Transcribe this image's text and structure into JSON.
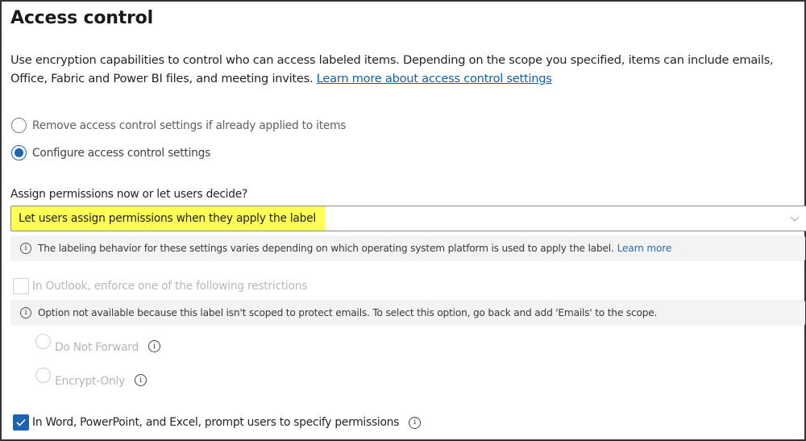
{
  "page": {
    "title": "Access control",
    "description": "Use encryption capabilities to control who can access labeled items. Depending on the scope you specified, items can include emails, Office, Fabric and Power BI files, and meeting invites.",
    "description_link": "Learn more about access control settings"
  },
  "mode_options": [
    {
      "label": "Remove access control settings if already applied to items",
      "selected": false
    },
    {
      "label": "Configure access control settings",
      "selected": true
    }
  ],
  "assign_permissions": {
    "label": "Assign permissions now or let users decide?",
    "selected_value": "Let users assign permissions when they apply the label",
    "highlight_color": "#ffff55",
    "chevron_icon": "chevron-down-icon"
  },
  "platform_info": {
    "icon": "info-icon",
    "text": "The labeling behavior for these settings varies depending on which operating system platform is used to apply the label.",
    "link": "Learn more"
  },
  "outlook_restriction": {
    "label": "In Outlook, enforce one of the following restrictions",
    "checked": false,
    "disabled": true,
    "info_text": "Option not available because this label isn't scoped to protect emails. To select this option, go back and add 'Emails' to the scope.",
    "options": [
      {
        "label": "Do Not Forward",
        "selected": false,
        "disabled": true
      },
      {
        "label": "Encrypt-Only",
        "selected": false,
        "disabled": true
      }
    ]
  },
  "office_prompt": {
    "label": "In Word, PowerPoint, and Excel, prompt users to specify permissions",
    "checked": true
  },
  "colors": {
    "accent": "#1f62b0",
    "link": "#0f5fad",
    "info_bar_bg": "#f3f3f3"
  }
}
